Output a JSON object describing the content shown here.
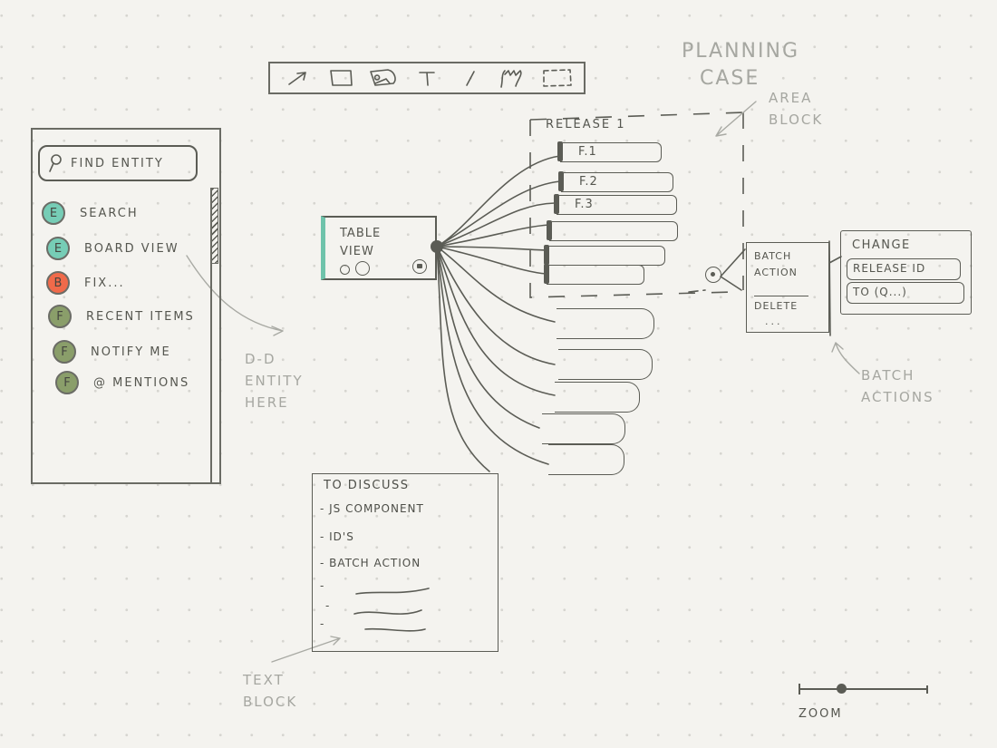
{
  "toolbar": {
    "tools": [
      {
        "name": "arrow",
        "icon": "arrow-icon"
      },
      {
        "name": "rectangle",
        "icon": "rectangle-icon"
      },
      {
        "name": "image",
        "icon": "image-icon"
      },
      {
        "name": "text",
        "icon": "text-icon",
        "glyph": "T"
      },
      {
        "name": "line",
        "icon": "line-icon"
      },
      {
        "name": "hand",
        "icon": "hand-icon"
      },
      {
        "name": "area-select",
        "icon": "dashed-rectangle-icon"
      }
    ]
  },
  "sidebar": {
    "search_placeholder": "Find entity",
    "items": [
      {
        "badge": "E",
        "label": "Search",
        "color": "#76cdb6"
      },
      {
        "badge": "E",
        "label": "Board view",
        "color": "#76cdb6"
      },
      {
        "badge": "B",
        "label": "Fix...",
        "color": "#f06a4a"
      },
      {
        "badge": "F",
        "label": "Recent items",
        "color": "#8a9e6a"
      },
      {
        "badge": "F",
        "label": "Notify me",
        "color": "#8a9e6a"
      },
      {
        "badge": "F",
        "label": "@ mentions",
        "color": "#8a9e6a"
      }
    ]
  },
  "table_card": {
    "title_line1": "Table",
    "title_line2": "view",
    "accent": "#6fc3ab"
  },
  "release": {
    "title": "Release 1",
    "features": [
      "F.1",
      "F.2",
      "F.3",
      "",
      "",
      ""
    ]
  },
  "batch": {
    "title_line1": "Batch",
    "title_line2": "action",
    "delete_label": "Delete",
    "more_label": "...",
    "change_title": "Change",
    "change_option1": "Release ID",
    "change_option2": "To (Q...)"
  },
  "notes": {
    "title": "To discuss",
    "items": [
      "- JS component",
      "- ID's",
      "- Batch action",
      "-",
      "-",
      "-"
    ]
  },
  "annotations": {
    "planning_case": [
      "Planning",
      "case"
    ],
    "area_block": [
      "Area",
      "block"
    ],
    "dnd": [
      "D-D",
      "entity",
      "here"
    ],
    "batch_actions": [
      "Batch",
      "actions"
    ],
    "text_block": [
      "Text",
      "block"
    ]
  },
  "zoom": {
    "label": "Zoom",
    "level": 0.33
  }
}
